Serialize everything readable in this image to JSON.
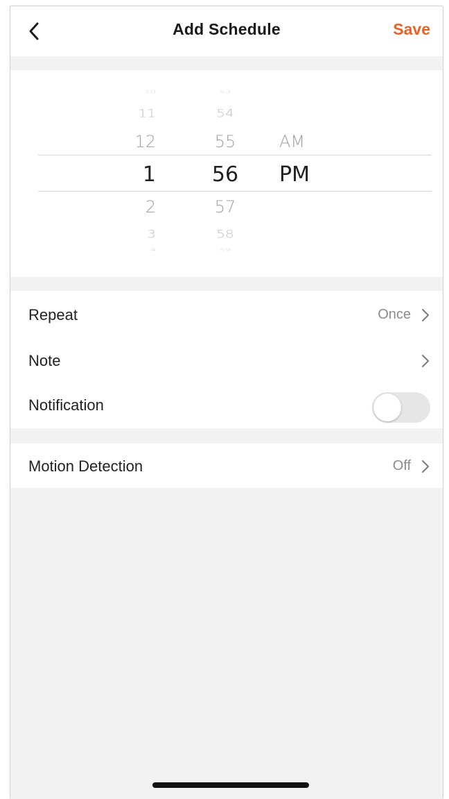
{
  "header": {
    "title": "Add Schedule",
    "save_label": "Save"
  },
  "picker": {
    "hours": [
      "10",
      "11",
      "12",
      "1",
      "2",
      "3",
      "4"
    ],
    "minutes": [
      "53",
      "54",
      "55",
      "56",
      "57",
      "58",
      "59"
    ],
    "ampm": [
      "AM",
      "PM"
    ],
    "selected": {
      "hour": "1",
      "minute": "56",
      "ampm": "PM"
    }
  },
  "settings": {
    "repeat": {
      "label": "Repeat",
      "value": "Once"
    },
    "note": {
      "label": "Note"
    },
    "notification": {
      "label": "Notification",
      "enabled": false
    }
  },
  "motion": {
    "label": "Motion Detection",
    "value": "Off"
  },
  "colors": {
    "accent": "#e8622a",
    "background": "#f2f2f2",
    "text": "#222222",
    "muted": "#8c8c8c"
  },
  "icons": {
    "back": "chevron-left-icon",
    "row_arrow": "chevron-right-icon"
  }
}
